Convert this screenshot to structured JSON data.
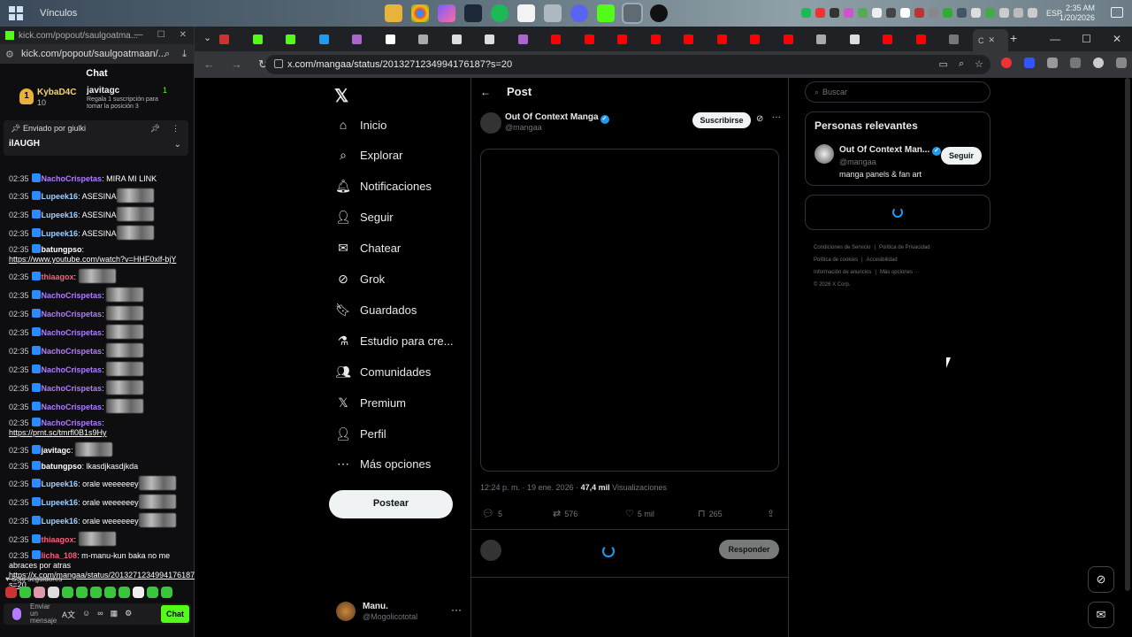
{
  "taskbar": {
    "window_title": "Vínculos",
    "language": "ESP",
    "time": "2:35 AM",
    "date": "1/20/2026"
  },
  "kick": {
    "titlebar_url": "kick.com/popout/saulgoatma...",
    "address": "kick.com/popout/saulgoatmaan/...",
    "chat_title": "Chat",
    "leader1": {
      "name": "KybaD4C",
      "rank": "1",
      "count": "10"
    },
    "leader2": {
      "name": "javitagc",
      "count": "1",
      "note": "Regala 1 suscripción para tomar la posición 3"
    },
    "pinned": {
      "sent_by": "Enviado por",
      "user": "giulki",
      "text": "ilAUGH"
    },
    "messages": [
      {
        "time": "02:35",
        "user": "NachoCrispetas",
        "color": "#b07cff",
        "text": "MIRA MI LINK"
      },
      {
        "time": "02:35",
        "user": "Lupeek16",
        "color": "#9fd2ff",
        "text": "ASESINA",
        "emote": true
      },
      {
        "time": "02:35",
        "user": "Lupeek16",
        "color": "#9fd2ff",
        "text": "ASESINA",
        "emote": true
      },
      {
        "time": "02:35",
        "user": "Lupeek16",
        "color": "#9fd2ff",
        "text": "ASESINA",
        "emote": true
      },
      {
        "time": "02:35",
        "user": "batungpso",
        "color": "#ffffff",
        "text": "",
        "link": "https://www.youtube.com/watch?v=HHF0xlf-bjY"
      },
      {
        "time": "02:35",
        "user": "thiaagox",
        "color": "#ff5c7a",
        "text": "",
        "emote": true
      },
      {
        "time": "02:35",
        "user": "NachoCrispetas",
        "color": "#b07cff",
        "text": "",
        "emote": true
      },
      {
        "time": "02:35",
        "user": "NachoCrispetas",
        "color": "#b07cff",
        "text": "",
        "emote": true
      },
      {
        "time": "02:35",
        "user": "NachoCrispetas",
        "color": "#b07cff",
        "text": "",
        "emote": true
      },
      {
        "time": "02:35",
        "user": "NachoCrispetas",
        "color": "#b07cff",
        "text": "",
        "emote": true
      },
      {
        "time": "02:35",
        "user": "NachoCrispetas",
        "color": "#b07cff",
        "text": "",
        "emote": true
      },
      {
        "time": "02:35",
        "user": "NachoCrispetas",
        "color": "#b07cff",
        "text": "",
        "emote": true
      },
      {
        "time": "02:35",
        "user": "NachoCrispetas",
        "color": "#b07cff",
        "text": "",
        "emote": true
      },
      {
        "time": "02:35",
        "user": "NachoCrispetas",
        "color": "#b07cff",
        "text": "",
        "link": "https://prnt.sc/tmrfl0B1s9Hy"
      },
      {
        "time": "02:35",
        "user": "javitagc",
        "color": "#ffffff",
        "text": "",
        "emote": true
      },
      {
        "time": "02:35",
        "user": "batungpso",
        "color": "#ffffff",
        "text": "lkasdjkasdjkda"
      },
      {
        "time": "02:35",
        "user": "Lupeek16",
        "color": "#9fd2ff",
        "text": "orale weeeeeey",
        "emote": true
      },
      {
        "time": "02:35",
        "user": "Lupeek16",
        "color": "#9fd2ff",
        "text": "orale weeeeeey",
        "emote": true
      },
      {
        "time": "02:35",
        "user": "Lupeek16",
        "color": "#9fd2ff",
        "text": "orale weeeeeey",
        "emote": true
      },
      {
        "time": "02:35",
        "user": "thiaagox",
        "color": "#ff5c7a",
        "text": "",
        "emote": true
      },
      {
        "time": "02:35",
        "user": "licha_108",
        "color": "#ff5c7a",
        "text": "m-manu-kun baka no me abraces por atras",
        "link": "https://x.com/mangaa/status/2013271234994176187?s=20"
      }
    ],
    "follow_only": "Solo seguidores",
    "input_placeholder": "Enviar un mensaje",
    "send_label": "Chat"
  },
  "chrome": {
    "url": "x.com/mangaa/status/2013271234994176187?s=20",
    "active_tab_label": "C"
  },
  "x": {
    "logo": "𝕏",
    "nav": [
      {
        "label": "Inicio",
        "icon": "home-icon",
        "glyph": "⌂"
      },
      {
        "label": "Explorar",
        "icon": "search-icon",
        "glyph": "⌕"
      },
      {
        "label": "Notificaciones",
        "icon": "bell-icon",
        "glyph": "🔔︎"
      },
      {
        "label": "Seguir",
        "icon": "add-user-icon",
        "glyph": "👤︎"
      },
      {
        "label": "Chatear",
        "icon": "mail-icon",
        "glyph": "✉"
      },
      {
        "label": "Grok",
        "icon": "grok-icon",
        "glyph": "⊘"
      },
      {
        "label": "Guardados",
        "icon": "bookmark-icon",
        "glyph": "🔖︎"
      },
      {
        "label": "Estudio para cre...",
        "icon": "flask-icon",
        "glyph": "⚗"
      },
      {
        "label": "Comunidades",
        "icon": "communities-icon",
        "glyph": "👥︎"
      },
      {
        "label": "Premium",
        "icon": "x-premium-icon",
        "glyph": "𝕏"
      },
      {
        "label": "Perfil",
        "icon": "profile-icon",
        "glyph": "👤︎"
      },
      {
        "label": "Más opciones",
        "icon": "more-circle-icon",
        "glyph": "⋯"
      }
    ],
    "post_button": "Postear",
    "account": {
      "name": "Manu.",
      "handle": "@Mogolicototal"
    },
    "header_title": "Post",
    "author": {
      "name": "Out Of Context Manga",
      "handle": "@mangaa",
      "subscribe": "Suscribirse"
    },
    "meta": {
      "time": "12:24 p. m. · 19 ene. 2026 · ",
      "views": "47,4 mil",
      "views_label": " Visualizaciones"
    },
    "actions": {
      "replies": "5",
      "reposts": "576",
      "likes": "5 mil",
      "bookmarks": "265"
    },
    "reply_button": "Responder",
    "search_placeholder": "Buscar",
    "relevant": {
      "title": "Personas relevantes",
      "name": "Out Of Context Man...",
      "handle": "@mangaa",
      "bio": "manga panels & fan art",
      "follow": "Seguir"
    },
    "footer": [
      "Condiciones de Servicio",
      "Política de Privacidad",
      "Política de cookies",
      "Accesibilidad",
      "Información de anuncios",
      "Más opciones ···",
      "© 2026 X Corp."
    ]
  },
  "colors": {
    "accent_blue": "#1d9bf0",
    "kick_green": "#53fc18"
  }
}
